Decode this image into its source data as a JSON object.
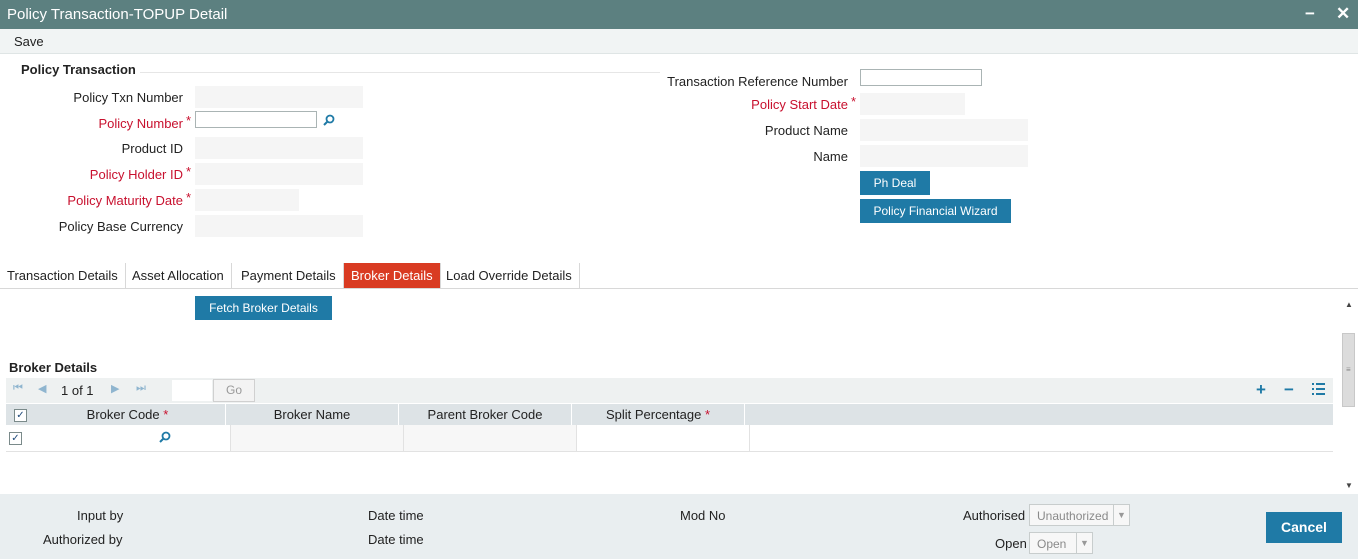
{
  "window": {
    "title": "Policy Transaction-TOPUP Detail",
    "minimize_glyph": "−",
    "close_glyph": "✕"
  },
  "toolbar": {
    "save_label": "Save"
  },
  "policy_transaction": {
    "section_title": "Policy Transaction",
    "fields": {
      "policy_txn_number": {
        "label": "Policy Txn Number",
        "value": ""
      },
      "policy_number": {
        "label": "Policy Number",
        "value": ""
      },
      "product_id": {
        "label": "Product ID",
        "value": ""
      },
      "policy_holder_id": {
        "label": "Policy Holder ID",
        "value": ""
      },
      "policy_maturity_date": {
        "label": "Policy Maturity Date",
        "value": ""
      },
      "policy_base_currency": {
        "label": "Policy Base Currency",
        "value": ""
      },
      "transaction_reference_number": {
        "label": "Transaction Reference Number",
        "value": ""
      },
      "policy_start_date": {
        "label": "Policy Start Date",
        "value": ""
      },
      "product_name": {
        "label": "Product Name",
        "value": ""
      },
      "name": {
        "label": "Name",
        "value": ""
      }
    },
    "required_marker": "*",
    "ph_deal_label": "Ph Deal",
    "policy_financial_wizard_label": "Policy Financial Wizard"
  },
  "tabs": [
    {
      "label": "Transaction Details",
      "active": false
    },
    {
      "label": "Asset Allocation",
      "active": false
    },
    {
      "label": "Payment Details",
      "active": false
    },
    {
      "label": "Broker Details",
      "active": true
    },
    {
      "label": "Load Override Details",
      "active": false
    }
  ],
  "broker": {
    "fetch_label": "Fetch Broker Details",
    "section_title": "Broker Details",
    "pager": {
      "page_text": "1 of 1",
      "go_label": "Go"
    },
    "columns": [
      "Broker Code",
      "Broker Name",
      "Parent Broker Code",
      "Split Percentage"
    ],
    "rows": [
      {
        "broker_code": "",
        "broker_name": "",
        "parent_broker_code": "",
        "split_percentage": "",
        "checked": true
      }
    ],
    "header_checked": true
  },
  "footer": {
    "input_by": "Input by",
    "authorized_by": "Authorized by",
    "date_time_1": "Date time",
    "date_time_2": "Date time",
    "mod_no": "Mod No",
    "authorised_label": "Authorised",
    "authorised_value": "Unauthorized",
    "open_label": "Open",
    "open_value": "Open",
    "cancel_label": "Cancel"
  },
  "colors": {
    "title_bar": "#5c8080",
    "accent_blue": "#1f7aa6",
    "active_tab": "#d93b22",
    "required": "#c8102e"
  }
}
